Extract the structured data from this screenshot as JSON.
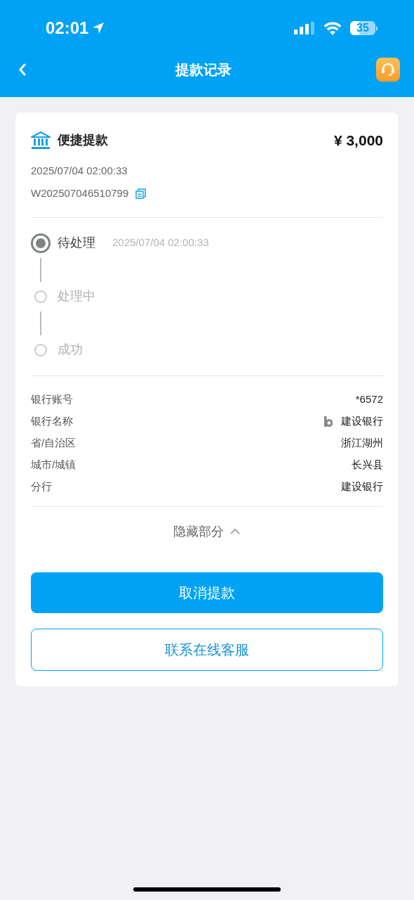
{
  "status_bar": {
    "time": "02:01",
    "battery": "35"
  },
  "header": {
    "title": "提款记录"
  },
  "record": {
    "method": "便捷提款",
    "amount": "¥ 3,000",
    "datetime": "2025/07/04 02:00:33",
    "order_id": "W202507046510799"
  },
  "steps": [
    {
      "label": "待处理",
      "time": "2025/07/04 02:00:33",
      "active": true
    },
    {
      "label": "处理中",
      "active": false
    },
    {
      "label": "成功",
      "active": false
    }
  ],
  "details": [
    {
      "label": "银行账号",
      "value": "*6572",
      "kind": "text"
    },
    {
      "label": "银行名称",
      "value": "建设银行",
      "kind": "bank"
    },
    {
      "label": "省/自治区",
      "value": "浙江湖州",
      "kind": "text"
    },
    {
      "label": "城市/城镇",
      "value": "长兴县",
      "kind": "text"
    },
    {
      "label": "分行",
      "value": "建设银行",
      "kind": "text"
    }
  ],
  "toggle": {
    "label": "隐藏部分",
    "expanded": true
  },
  "buttons": [
    {
      "label": "取消提款",
      "kind": "primary"
    },
    {
      "label": "联系在线客服",
      "kind": "outline"
    }
  ]
}
